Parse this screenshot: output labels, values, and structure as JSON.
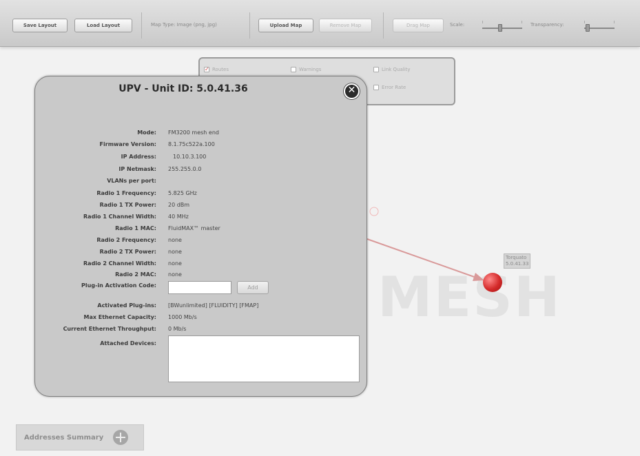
{
  "toolbar": {
    "save_layout": "Save Layout",
    "load_layout": "Load Layout",
    "map_type": "Map Type: Image (png, jpg)",
    "upload_map": "Upload Map",
    "remove_map": "Remove Map",
    "drag_map": "Drag Map",
    "scale_label": "Scale:",
    "transparency_label": "Transparency:"
  },
  "overlay": {
    "routes": "Routes",
    "warnings": "Warnings",
    "link_quality": "Link Quality",
    "error_rate": "Error Rate"
  },
  "map": {
    "watermark": "MESH",
    "node_name": "Torquato",
    "node_id": "5.0.41.33"
  },
  "dialog": {
    "title": "UPV - Unit ID: 5.0.41.36",
    "close_glyph": "✕",
    "mode_label": "Mode:",
    "mode_value": "FM3200 mesh end",
    "fw_label": "Firmware Version:",
    "fw_value": "8.1.75c522a.100",
    "ip_label": "IP Address:",
    "ip_value": "10.10.3.100",
    "netmask_label": "IP Netmask:",
    "netmask_value": "255.255.0.0",
    "vlans_label": "VLANs per port:",
    "vlans_value": "",
    "r1_freq_label": "Radio 1 Frequency:",
    "r1_freq_value": "5.825 GHz",
    "r1_tx_label": "Radio 1 TX Power:",
    "r1_tx_value": "20 dBm",
    "r1_cw_label": "Radio 1 Channel Width:",
    "r1_cw_value": "40 MHz",
    "r1_mac_label": "Radio 1 MAC:",
    "r1_mac_value": "FluidMAX™ master",
    "r2_freq_label": "Radio 2 Frequency:",
    "r2_freq_value": "none",
    "r2_tx_label": "Radio 2 TX Power:",
    "r2_tx_value": "none",
    "r2_cw_label": "Radio 2 Channel Width:",
    "r2_cw_value": "none",
    "r2_mac_label": "Radio 2 MAC:",
    "r2_mac_value": "none",
    "plugin_label": "Plug-in Activation Code:",
    "plugin_input_value": "",
    "add_button": "Add",
    "activated_label": "Activated Plug-ins:",
    "activated_value": "[BWunlimited] [FLUIDITY] [FMAP]",
    "max_eth_label": "Max Ethernet Capacity:",
    "max_eth_value": "1000 Mb/s",
    "cur_eth_label": "Current Ethernet Throughput:",
    "cur_eth_value": "0 Mb/s",
    "attached_label": "Attached Devices:"
  },
  "addresses_summary": "Addresses Summary",
  "colors": {
    "link_line": "#d99a9a",
    "node": "#d42a2a",
    "dialog_bg": "#c9c9c9"
  }
}
